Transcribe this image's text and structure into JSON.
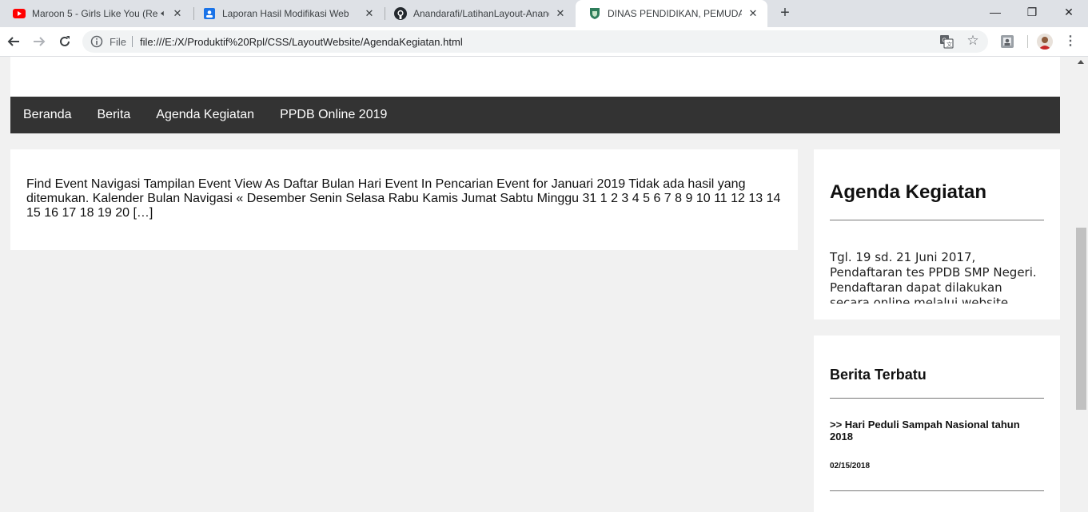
{
  "browser": {
    "tabs": [
      {
        "title": "Maroon 5 - Girls Like You (Re",
        "icon": "youtube-icon",
        "audio": "speaker-icon"
      },
      {
        "title": "Laporan Hasil Modifikasi Web",
        "icon": "google-docs-icon"
      },
      {
        "title": "Anandarafi/LatihanLayout-Anand",
        "icon": "github-icon"
      },
      {
        "title": "DINAS PENDIDIKAN, PEMUDA DA",
        "icon": "site-shield-icon",
        "active": true
      }
    ],
    "new_tab": "+",
    "window": {
      "minimize": "—",
      "restore": "❐",
      "close": "✕"
    },
    "address": {
      "scheme_label": "File",
      "url": "file:///E:/X/Produktif%20Rpl/CSS/LayoutWebsite/AgendaKegiatan.html"
    }
  },
  "nav": {
    "items": [
      "Beranda",
      "Berita",
      "Agenda Kegiatan",
      "PPDB Online 2019"
    ]
  },
  "main": {
    "text": "Find Event Navigasi Tampilan Event View As Daftar Bulan Hari Event In Pencarian Event for Januari 2019 Tidak ada hasil yang ditemukan. Kalender Bulan Navigasi « Desember Senin Selasa Rabu Kamis Jumat Sabtu Minggu 31 1 2 3 4 5 6 7 8 9 10 11 12 13 14 15 16 17 18 19 20 […]"
  },
  "sidebar": {
    "agenda": {
      "title": "Agenda Kegiatan",
      "text": "Tgl. 19 sd. 21 Juni 2017, Pendaftaran tes PPDB SMP Negeri. Pendaftaran dapat dilakukan secara online melalui website"
    },
    "berita": {
      "title": "Berita Terbatu",
      "item_link": ">> Hari Peduli Sampah Nasional tahun 2018",
      "item_date": "02/15/2018"
    }
  },
  "colors": {
    "navbar_bg": "#333333",
    "page_bg": "#f1f1f1",
    "card_bg": "#ffffff"
  }
}
